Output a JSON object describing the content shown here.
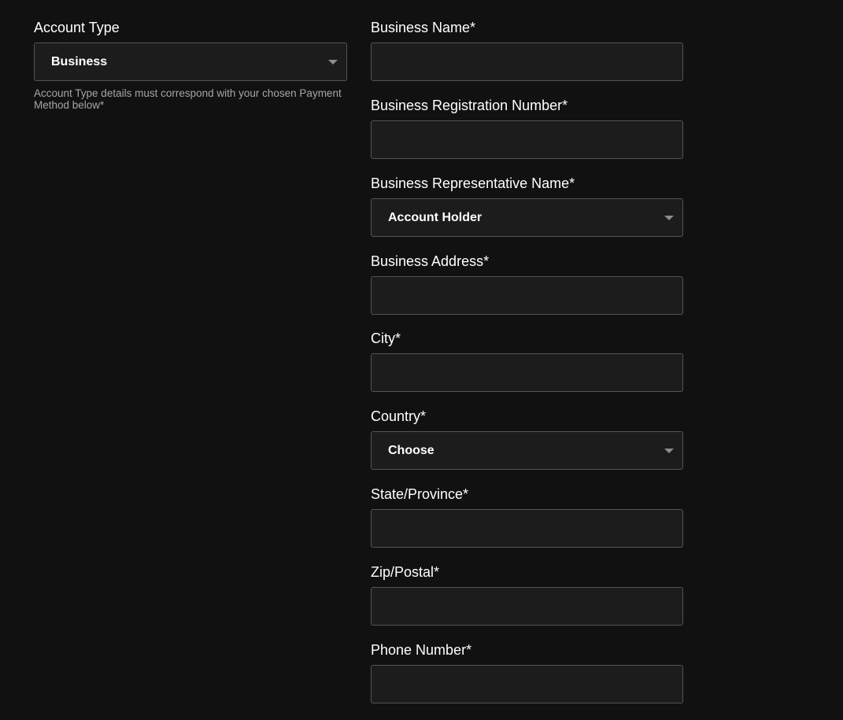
{
  "account_type": {
    "label": "Account Type",
    "selected": "Business",
    "help": "Account Type details must correspond with your chosen Payment Method below*"
  },
  "fields": {
    "business_name": {
      "label": "Business Name*",
      "value": ""
    },
    "registration_number": {
      "label": "Business Registration Number*",
      "value": ""
    },
    "representative_name": {
      "label": "Business Representative Name*",
      "selected": "Account Holder"
    },
    "business_address": {
      "label": "Business Address*",
      "value": ""
    },
    "city": {
      "label": "City*",
      "value": ""
    },
    "country": {
      "label": "Country*",
      "selected": "Choose"
    },
    "state_province": {
      "label": "State/Province*",
      "value": ""
    },
    "zip_postal": {
      "label": "Zip/Postal*",
      "value": ""
    },
    "phone_number": {
      "label": "Phone Number*",
      "value": ""
    }
  },
  "icons": {
    "dropdown": "chevron-down-icon"
  },
  "colors": {
    "background": "#111111",
    "field_background": "#1c1c1d",
    "field_border": "#545456",
    "help_text": "#a6a6a8",
    "caret": "#8d8d8f"
  }
}
